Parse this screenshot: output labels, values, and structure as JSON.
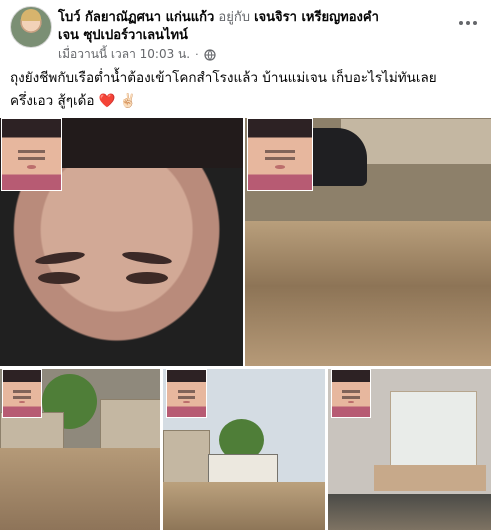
{
  "post": {
    "author": "โบว์ กัลยาณัฏศนา แก่นแก้ว",
    "with_label": "อยู่กับ",
    "tagged": "เจนจิรา เหรียญทองคำ",
    "tagged_line2": "เจน ซุปเปอร์วาเลนไทน์",
    "time": "เมื่อวานนี้ เวลา 10:03 น.",
    "separator": "·",
    "audience_icon": "globe-icon",
    "text_line1": "ถุงยังชีพกับเรือต่ำน้ำต้องเข้าโคกสำโรงแล้ว บ้านแม่เจน เก็บอะไรไม่ทันเลย",
    "text_line2": "ครึ่งเอว สู้ๆเด้อ",
    "emoji_heart": "❤️",
    "emoji_peace": "✌🏻"
  },
  "photos": [
    {
      "name": "selfie-with-mask-photo"
    },
    {
      "name": "flooded-street-with-car-photo"
    },
    {
      "name": "flooded-houses-photo"
    },
    {
      "name": "flooded-road-truck-photo"
    },
    {
      "name": "flooded-house-interior-photo"
    }
  ],
  "colors": {
    "text": "#050505",
    "secondary": "#65676b",
    "heart": "#e41e3f"
  }
}
